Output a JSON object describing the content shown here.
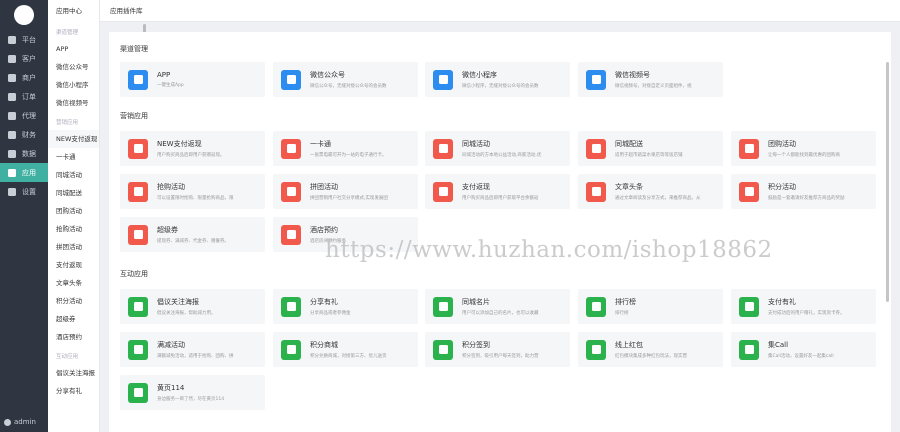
{
  "nav": {
    "items": [
      {
        "label": "平台",
        "icon": "monitor-icon"
      },
      {
        "label": "客户",
        "icon": "user-icon"
      },
      {
        "label": "商户",
        "icon": "store-icon"
      },
      {
        "label": "订单",
        "icon": "list-icon"
      },
      {
        "label": "代理",
        "icon": "agent-icon"
      },
      {
        "label": "财务",
        "icon": "wallet-icon"
      },
      {
        "label": "数据",
        "icon": "chart-icon"
      },
      {
        "label": "应用",
        "icon": "apps-icon",
        "active": true
      },
      {
        "label": "设置",
        "icon": "gear-icon"
      }
    ],
    "user": "admin"
  },
  "subnav": {
    "title": "应用中心",
    "groups": [
      {
        "title": "渠道管理",
        "items": [
          "APP",
          "微信公众号",
          "微信小程序",
          "微信视频号"
        ]
      },
      {
        "title": "营销应用",
        "items": [
          "NEW支付返现",
          "一卡通",
          "同城活动",
          "同城配送",
          "团购活动",
          "抢购活动",
          "拼团活动",
          "支付返现",
          "文章头条",
          "积分活动",
          "超级券",
          "酒店预约"
        ]
      },
      {
        "title": "互动应用",
        "items": [
          "倡议关注海报",
          "分享有礼"
        ]
      }
    ]
  },
  "header": {
    "title": "应用插件库"
  },
  "sections": [
    {
      "title": "渠道管理",
      "cards": [
        {
          "title": "APP",
          "desc": "一键生成App",
          "color": "#2d8cf0"
        },
        {
          "title": "微信公众号",
          "desc": "微信公众号，无缝对接公众号的会员数",
          "color": "#2d8cf0"
        },
        {
          "title": "微信小程序",
          "desc": "微信小程序，无缝对接公众号的会员数",
          "color": "#2d8cf0"
        },
        {
          "title": "微信视频号",
          "desc": "微信视频号，对接自定义页面组件，视",
          "color": "#2d8cf0"
        }
      ]
    },
    {
      "title": "营销应用",
      "cards": [
        {
          "title": "NEW支付返现",
          "desc": "用户购买商品后即用户获赠返现。",
          "color": "#f0594b"
        },
        {
          "title": "一卡通",
          "desc": "一张票电最可开为一站的电子通行卡。",
          "color": "#f0594b"
        },
        {
          "title": "同城活动",
          "desc": "同城活动的方本地公益活动,商家活动,优",
          "color": "#f0594b"
        },
        {
          "title": "同城配送",
          "desc": "适用于超市蔬菜水果店等等饭店铺",
          "color": "#f0594b"
        },
        {
          "title": "团购活动",
          "desc": "让每一个人都能找到最优惠的团购商",
          "color": "#f0594b"
        },
        {
          "title": "抢购活动",
          "desc": "可以设置限时抢购、限量抢购商品，限",
          "color": "#f0594b"
        },
        {
          "title": "拼团活动",
          "desc": "拼团营销用户社交分享模式,实现发展团",
          "color": "#f0594b"
        },
        {
          "title": "支付返现",
          "desc": "用户购买商品后即用户获取平台余额返",
          "color": "#f0594b"
        },
        {
          "title": "文章头条",
          "desc": "通过文章阅读及分享方式，来推荐商品，从",
          "color": "#f0594b"
        },
        {
          "title": "积分活动",
          "desc": "鼓励是一套邀请好友推荐方商品的奖励",
          "color": "#f0594b"
        },
        {
          "title": "超级券",
          "desc": "提现券、满减券、代金券、赠餐券。",
          "color": "#f0594b"
        },
        {
          "title": "酒店预约",
          "desc": "酒店房间预约服务",
          "color": "#f0594b"
        }
      ]
    },
    {
      "title": "互动应用",
      "cards": [
        {
          "title": "倡议关注海报",
          "desc": "倡议关注海报，帮助减力用。",
          "color": "#2bb24c"
        },
        {
          "title": "分享有礼",
          "desc": "分享商品或者参佣金",
          "color": "#2bb24c"
        },
        {
          "title": "同城名片",
          "desc": "用户可以添加自己的名片，也可以收藏",
          "color": "#2bb24c"
        },
        {
          "title": "排行榜",
          "desc": "排行榜",
          "color": "#2bb24c"
        },
        {
          "title": "支付有礼",
          "desc": "支付成功后的用户赠礼，实现资卡券。",
          "color": "#2bb24c"
        },
        {
          "title": "满减活动",
          "desc": "满额减免活动，适用于抢购、团购、拼",
          "color": "#2bb24c"
        },
        {
          "title": "积分商城",
          "desc": "积分兑换商城，对接第三方、优儿送货",
          "color": "#2bb24c"
        },
        {
          "title": "积分签到",
          "desc": "积分签到，吸引用户每天签到，助力营",
          "color": "#2bb24c"
        },
        {
          "title": "线上红包",
          "desc": "红包模块集成多种红包玩法，现实营",
          "color": "#2bb24c"
        },
        {
          "title": "集Call",
          "desc": "集Call活动，设置好友一起集call",
          "color": "#2bb24c"
        },
        {
          "title": "黄页114",
          "desc": "身边服务一目了然，尽在黄页114",
          "color": "#2bb24c"
        }
      ]
    }
  ],
  "watermark": "https://www.huzhan.com/ishop18862"
}
